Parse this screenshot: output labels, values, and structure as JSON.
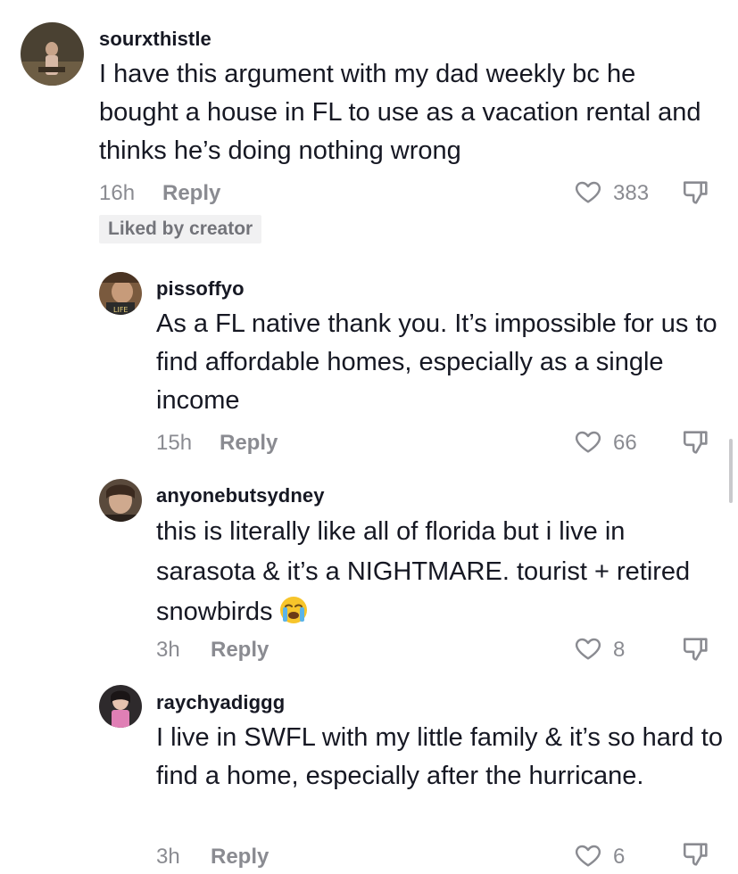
{
  "comments": [
    {
      "username": "sourxthistle",
      "text": "I have this argument with my dad weekly bc he bought a house in FL to use as a vacation rental and thinks he’s doing nothing wrong",
      "time": "16h",
      "reply_label": "Reply",
      "likes": "383",
      "badge": "Liked by creator"
    },
    {
      "username": "pissoffyo",
      "text": "As a FL native thank you. It’s impossible for us to find affordable homes, especially as a single income",
      "time": "15h",
      "reply_label": "Reply",
      "likes": "66"
    },
    {
      "username": "anyonebutsydney",
      "text": "this is literally like all of florida but i live in sarasota & it’s a NIGHTMARE. tourist + retired snowbirds",
      "time": "3h",
      "reply_label": "Reply",
      "likes": "8",
      "emoji": "loudly-crying-face-emoji"
    },
    {
      "username": "raychyadiggg",
      "text": "I live in SWFL with my little family & it’s so hard to find a home, especially after the hurricane.",
      "time": "3h",
      "reply_label": "Reply",
      "likes": "6"
    }
  ],
  "icons": {
    "like": "heart-outline-icon",
    "dislike": "thumbs-down-icon"
  },
  "colors": {
    "text_primary": "#161823",
    "text_secondary": "#8a8b91",
    "badge_bg": "#f1f1f2"
  }
}
